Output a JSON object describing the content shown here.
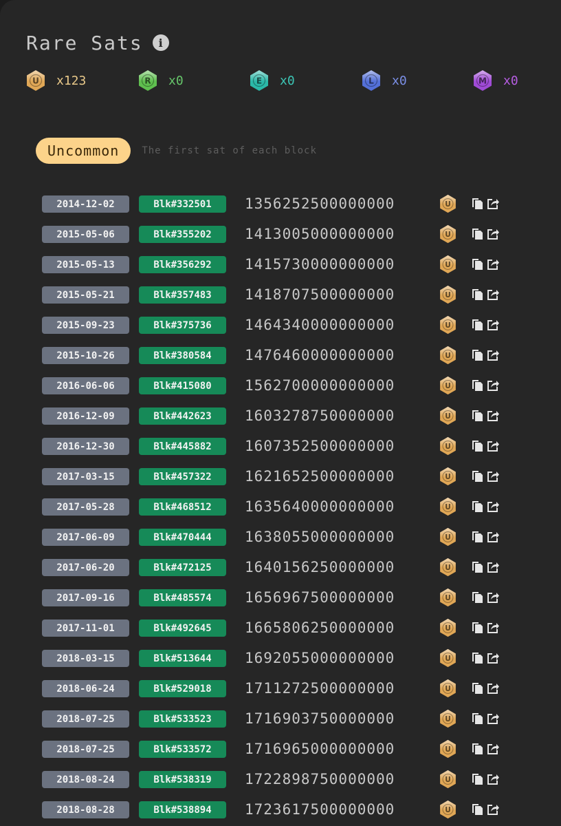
{
  "title": "Rare Sats",
  "colors": {
    "uncommon": "#e0a756",
    "rare": "#5fbf4f",
    "epic": "#2bb8a8",
    "legendary": "#5470d8",
    "mythic": "#a04bd6",
    "date_pill": "#6b7280",
    "block_pill": "#168a58"
  },
  "counts": [
    {
      "key": "uncommon",
      "letter": "U",
      "value": "x123",
      "color": "#e9c98a"
    },
    {
      "key": "rare",
      "letter": "R",
      "value": "x0",
      "color": "#66c56a"
    },
    {
      "key": "epic",
      "letter": "E",
      "value": "x0",
      "color": "#3cc4b4"
    },
    {
      "key": "legendary",
      "letter": "L",
      "value": "x0",
      "color": "#7b8fe6"
    },
    {
      "key": "mythic",
      "letter": "M",
      "value": "x0",
      "color": "#b65de2"
    }
  ],
  "section": {
    "tag": "Uncommon",
    "description": "The first sat of each block"
  },
  "rows": [
    {
      "date": "2014-12-02",
      "block": "Blk#332501",
      "sat": "1356252500000000",
      "badge": "U"
    },
    {
      "date": "2015-05-06",
      "block": "Blk#355202",
      "sat": "1413005000000000",
      "badge": "U"
    },
    {
      "date": "2015-05-13",
      "block": "Blk#356292",
      "sat": "1415730000000000",
      "badge": "U"
    },
    {
      "date": "2015-05-21",
      "block": "Blk#357483",
      "sat": "1418707500000000",
      "badge": "U"
    },
    {
      "date": "2015-09-23",
      "block": "Blk#375736",
      "sat": "1464340000000000",
      "badge": "U"
    },
    {
      "date": "2015-10-26",
      "block": "Blk#380584",
      "sat": "1476460000000000",
      "badge": "U"
    },
    {
      "date": "2016-06-06",
      "block": "Blk#415080",
      "sat": "1562700000000000",
      "badge": "U"
    },
    {
      "date": "2016-12-09",
      "block": "Blk#442623",
      "sat": "1603278750000000",
      "badge": "U"
    },
    {
      "date": "2016-12-30",
      "block": "Blk#445882",
      "sat": "1607352500000000",
      "badge": "U"
    },
    {
      "date": "2017-03-15",
      "block": "Blk#457322",
      "sat": "1621652500000000",
      "badge": "U"
    },
    {
      "date": "2017-05-28",
      "block": "Blk#468512",
      "sat": "1635640000000000",
      "badge": "U"
    },
    {
      "date": "2017-06-09",
      "block": "Blk#470444",
      "sat": "1638055000000000",
      "badge": "U"
    },
    {
      "date": "2017-06-20",
      "block": "Blk#472125",
      "sat": "1640156250000000",
      "badge": "U"
    },
    {
      "date": "2017-09-16",
      "block": "Blk#485574",
      "sat": "1656967500000000",
      "badge": "U"
    },
    {
      "date": "2017-11-01",
      "block": "Blk#492645",
      "sat": "1665806250000000",
      "badge": "U"
    },
    {
      "date": "2018-03-15",
      "block": "Blk#513644",
      "sat": "1692055000000000",
      "badge": "U"
    },
    {
      "date": "2018-06-24",
      "block": "Blk#529018",
      "sat": "1711272500000000",
      "badge": "U"
    },
    {
      "date": "2018-07-25",
      "block": "Blk#533523",
      "sat": "1716903750000000",
      "badge": "U"
    },
    {
      "date": "2018-07-25",
      "block": "Blk#533572",
      "sat": "1716965000000000",
      "badge": "U"
    },
    {
      "date": "2018-08-24",
      "block": "Blk#538319",
      "sat": "1722898750000000",
      "badge": "U"
    },
    {
      "date": "2018-08-28",
      "block": "Blk#538894",
      "sat": "1723617500000000",
      "badge": "U"
    }
  ]
}
